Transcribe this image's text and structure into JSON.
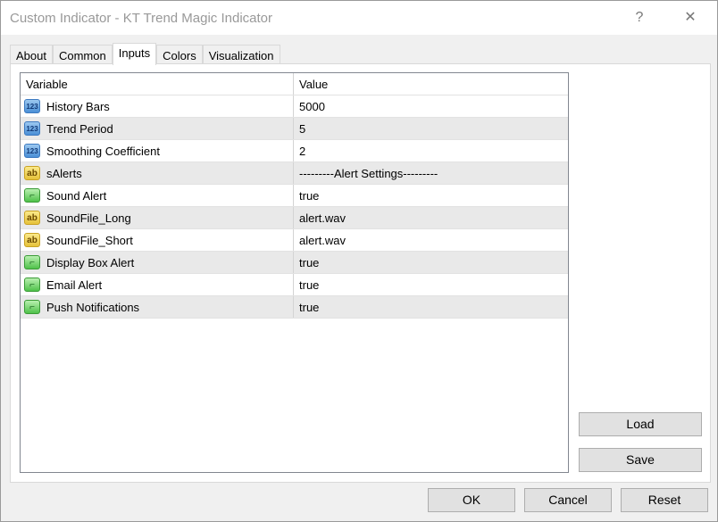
{
  "window": {
    "title": "Custom Indicator - KT Trend Magic Indicator",
    "help": "?",
    "close": "✕"
  },
  "tabs": [
    {
      "label": "About"
    },
    {
      "label": "Common"
    },
    {
      "label": "Inputs",
      "active": true
    },
    {
      "label": "Colors"
    },
    {
      "label": "Visualization"
    }
  ],
  "table": {
    "headers": [
      "Variable",
      "Value"
    ],
    "rows": [
      {
        "type": "int",
        "icon": "123",
        "name": "History Bars",
        "value": "5000"
      },
      {
        "type": "int",
        "icon": "123",
        "name": "Trend Period",
        "value": "5"
      },
      {
        "type": "int",
        "icon": "123",
        "name": "Smoothing Coefficient",
        "value": "2"
      },
      {
        "type": "string",
        "icon": "ab",
        "name": "sAlerts",
        "value": "---------Alert Settings---------"
      },
      {
        "type": "bool",
        "icon": "⌐",
        "name": "Sound Alert",
        "value": "true"
      },
      {
        "type": "string",
        "icon": "ab",
        "name": "SoundFile_Long",
        "value": "alert.wav"
      },
      {
        "type": "string",
        "icon": "ab",
        "name": "SoundFile_Short",
        "value": "alert.wav"
      },
      {
        "type": "bool",
        "icon": "⌐",
        "name": "Display Box Alert",
        "value": "true"
      },
      {
        "type": "bool",
        "icon": "⌐",
        "name": "Email Alert",
        "value": "true"
      },
      {
        "type": "bool",
        "icon": "⌐",
        "name": "Push Notifications",
        "value": "true"
      }
    ]
  },
  "side_buttons": {
    "load": "Load",
    "save": "Save"
  },
  "footer": {
    "ok": "OK",
    "cancel": "Cancel",
    "reset": "Reset"
  }
}
